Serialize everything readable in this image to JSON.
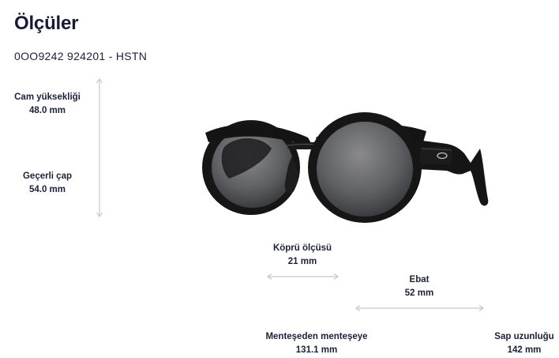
{
  "title": "Ölçüler",
  "model": "0OO9242 924201 - HSTN",
  "dimensions": {
    "lens_height": {
      "label": "Cam yüksekliği",
      "value": "48.0 mm"
    },
    "diameter": {
      "label": "Geçerli çap",
      "value": "54.0 mm"
    },
    "bridge": {
      "label": "Köprü ölçüsü",
      "value": "21 mm"
    },
    "ebat": {
      "label": "Ebat",
      "value": "52 mm"
    },
    "hinge": {
      "label": "Menteşeden menteşeye",
      "value": "131.1 mm"
    },
    "temple": {
      "label": "Sap uzunluğu",
      "value": "142 mm"
    }
  },
  "colors": {
    "text": "#1b2238",
    "arrow": "#c4c7ce",
    "frame": "#1a1a1a"
  },
  "icons": [
    "double-arrow-icon",
    "oakley-logo-icon"
  ]
}
